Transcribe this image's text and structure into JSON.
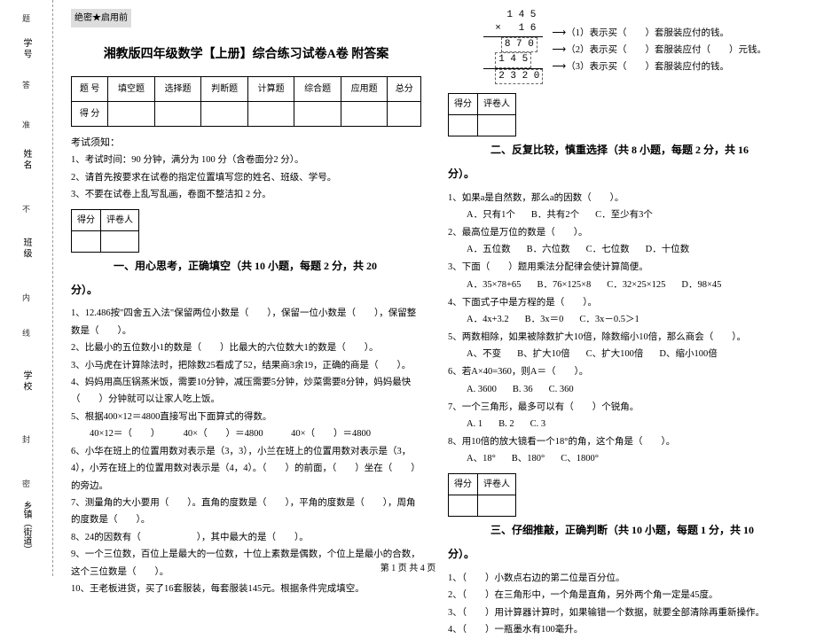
{
  "margin": {
    "l1": "乡镇（街道）",
    "l2": "学 校",
    "l3": "班 级",
    "l4": "姓 名",
    "l5": "学 号",
    "seal": "密",
    "cut": "封",
    "line": "线",
    "inside": "内",
    "no": "不",
    "zhun": "准",
    "answer": "答",
    "ti": "题"
  },
  "header": {
    "secret": "绝密★启用前",
    "title": "湘教版四年级数学【上册】综合练习试卷A卷 附答案"
  },
  "scoreTable": {
    "h0": "题 号",
    "h1": "填空题",
    "h2": "选择题",
    "h3": "判断题",
    "h4": "计算题",
    "h5": "综合题",
    "h6": "应用题",
    "h7": "总分",
    "r0": "得 分"
  },
  "notice": {
    "head": "考试须知：",
    "n1": "1、考试时间：90 分钟，满分为 100 分（含卷面分2 分）。",
    "n2": "2、请首先按要求在试卷的指定位置填写您的姓名、班级、学号。",
    "n3": "3、不要在试卷上乱写乱画，卷面不整洁扣 2 分。"
  },
  "scoreBox": {
    "c1": "得分",
    "c2": "评卷人"
  },
  "sec1": {
    "title": "一、用心思考，正确填空（共 10 小题，每题 2 分，共 20",
    "tail": "分）。",
    "q1": "1、12.486按\"四舍五入法\"保留两位小数是（　　），保留一位小数是（　　），保留整数是（　　）。",
    "q2": "2、比最小的五位数小1的数是（　　）比最大的六位数大1的数是（　　）。",
    "q3": "3、小马虎在计算除法时，把除数25看成了52，结果商3余19，正确的商是（　　）。",
    "q4": "4、妈妈用高压锅蒸米饭，需要10分钟，减压需要5分钟，炒菜需要8分钟，妈妈最快（　　）分钟就可以让家人吃上饭。",
    "q5": "5、根据400×12＝4800直接写出下面算式的得数。",
    "q5b": "　　40×12＝（　　）　　　40×（　　）＝4800　　　40×（　　）＝4800",
    "q6": "6、小华在班上的位置用数对表示是（3，3），小兰在班上的位置用数对表示是（3，4），小芳在班上的位置用数对表示是（4，4）。（　　）的前面，（　　）坐在（　　）的旁边。",
    "q7": "7、测量角的大小要用（　　）。直角的度数是（　　），平角的度数是（　　），周角的度数是（　　）。",
    "q8": "8、24的因数有（　　　　　　），其中最大的是（　　）。",
    "q9": "9、一个三位数，百位上是最大的一位数，十位上素数是偶数，个位上是最小的合数，这个三位数是（　　）。",
    "q10": "10、王老板进货，买了16套服装，每套服装145元。根据条件完成填空。"
  },
  "calc": {
    "l1": "    1 4 5",
    "l2": "  ×   1 6",
    "line1_val": "8 7 0",
    "line1": "（1）表示买（　　）套服装应付的钱。",
    "line2_val": "1 4 5",
    "line2": "（2）表示买（　　）套服装应付（　　）元钱。",
    "line3_val": "2 3 2 0",
    "line3": "（3）表示买（　　）套服装应付的钱。"
  },
  "sec2": {
    "title": "二、反复比较，慎重选择（共 8 小题，每题 2 分，共 16",
    "tail": "分）。",
    "q1": "1、如果a是自然数，那么a的因数（　　）。",
    "q1a": "A．只有1个",
    "q1b": "B．共有2个",
    "q1c": "C．至少有3个",
    "q2": "2、最高位是万位的数是（　　）。",
    "q2a": "A．五位数",
    "q2b": "B．六位数",
    "q2c": "C．七位数",
    "q2d": "D．十位数",
    "q3": "3、下面（　　）题用乘法分配律会使计算简便。",
    "q3a": "A．35×78+65",
    "q3b": "B．76×125×8",
    "q3c": "C．32×25×125",
    "q3d": "D．98×45",
    "q4": "4、下面式子中是方程的是（　　）。",
    "q4a": "A．4x+3.2",
    "q4b": "B．3x＝0",
    "q4c": "C．3x－0.5＞1",
    "q5": "5、两数相除，如果被除数扩大10倍，除数缩小10倍，那么商会（　　）。",
    "q5a": "A、不变",
    "q5b": "B、扩大10倍",
    "q5c": "C、扩大100倍",
    "q5d": "D、缩小100倍",
    "q6": "6、若A×40=360，则A＝（　　）。",
    "q6a": "A. 3600",
    "q6b": "B. 36",
    "q6c": "C. 360",
    "q7": "7、一个三角形，最多可以有（　　）个锐角。",
    "q7a": "A. 1",
    "q7b": "B. 2",
    "q7c": "C. 3",
    "q8": "8、用10倍的放大镜看一个18°的角，这个角是（　　）。",
    "q8a": "A、18°",
    "q8b": "B、180°",
    "q8c": "C、1800°"
  },
  "sec3": {
    "title": "三、仔细推敲，正确判断（共 10 小题，每题 1 分，共 10",
    "tail": "分）。",
    "q1": "1、（　　）小数点右边的第二位是百分位。",
    "q2": "2、（　　）在三角形中，一个角是直角，另外两个角一定是45度。",
    "q3": "3、（　　）用计算器计算时，如果输错一个数据，就要全部清除再重新操作。",
    "q4": "4、（　　）一瓶墨水有100毫升。"
  },
  "footer": "第 1 页 共 4 页"
}
